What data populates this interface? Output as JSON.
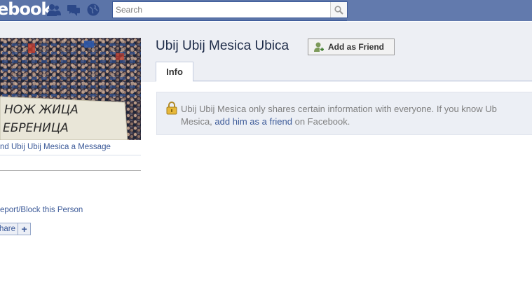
{
  "header": {
    "logo": "ebook",
    "search": {
      "placeholder": "Search",
      "value": ""
    }
  },
  "sidebar": {
    "send_message": "nd Ubij Ubij Mesica a Message",
    "report_block": "eport/Block this Person",
    "share_label": "hare",
    "share_plus": "+"
  },
  "photo": {
    "banner_line1": "НОЖ ЖИЦА",
    "banner_line2": "ЕБРЕНИЦА"
  },
  "profile": {
    "name": "Ubij Ubij Mesica Ubica",
    "add_friend": "Add as Friend",
    "tab": "Info"
  },
  "notice": {
    "text_before": "Ubij Ubij Mesica only shares certain information with everyone. If you know Ub",
    "text_line2_before": "Mesica, ",
    "link": "add him as a friend",
    "text_after": " on Facebook."
  },
  "colors": {
    "brand": "#3b5998",
    "topbar": "#5b74a8",
    "notice_bg": "#eceff5"
  }
}
